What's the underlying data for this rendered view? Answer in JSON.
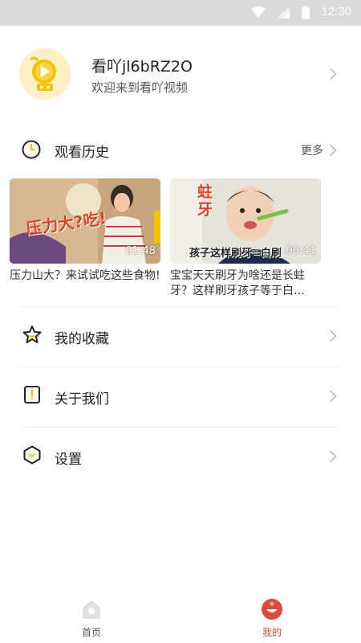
{
  "status_bar": {
    "time": "12:30"
  },
  "profile": {
    "username": "看吖jl6bRZ2O",
    "welcome": "欢迎来到看吖视频"
  },
  "history": {
    "title": "观看历史",
    "more": "更多",
    "videos": [
      {
        "title": "压力山大？来试试吃这些食物!",
        "duration": "01:48",
        "thumb_text": "压力大?吃!"
      },
      {
        "title": "宝宝天天刷牙为啥还是长蛀牙？这样刷牙孩子等于白…",
        "duration": "00:41",
        "thumb_text": "蛀牙",
        "caption": "孩子这样刷牙=白刷"
      }
    ]
  },
  "menu": [
    {
      "label": "我的收藏",
      "icon": "star-icon"
    },
    {
      "label": "关于我们",
      "icon": "info-icon"
    },
    {
      "label": "设置",
      "icon": "settings-hexagon-icon"
    }
  ],
  "tabbar": {
    "tabs": [
      {
        "label": "首页",
        "icon": "home-icon",
        "active": false,
        "color": "#555555"
      },
      {
        "label": "我的",
        "icon": "profile-tab-icon",
        "active": true,
        "color": "#e0483a"
      }
    ]
  },
  "colors": {
    "accent": "#e0483a",
    "icon_yellow": "#f5c200",
    "status_bar": "#d9d9d9"
  }
}
